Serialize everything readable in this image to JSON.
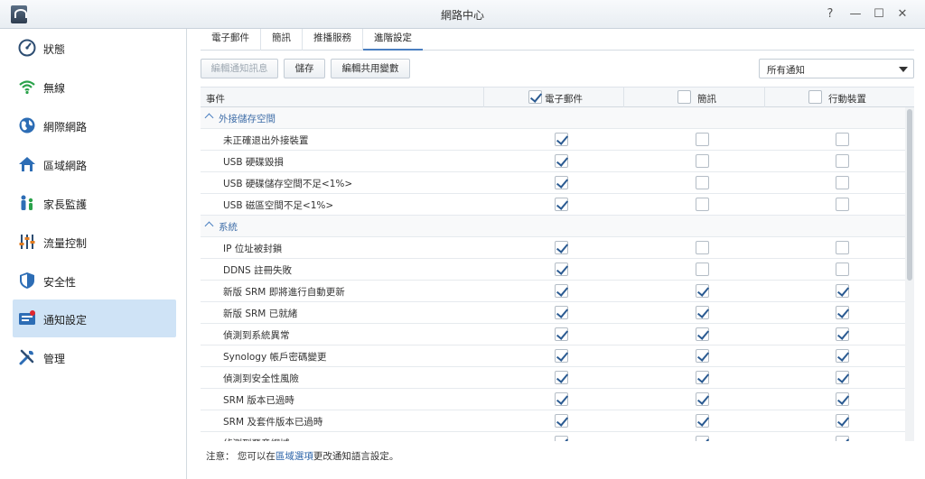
{
  "window": {
    "title": "網路中心",
    "help": "?",
    "minimize": "—",
    "maximize": "☐",
    "close": "✕"
  },
  "sidebar": {
    "items": [
      {
        "label": "狀態",
        "icon": "gauge-icon"
      },
      {
        "label": "無線",
        "icon": "wifi-icon"
      },
      {
        "label": "網際網路",
        "icon": "globe-icon"
      },
      {
        "label": "區域網路",
        "icon": "home-network-icon"
      },
      {
        "label": "家長監護",
        "icon": "family-icon"
      },
      {
        "label": "流量控制",
        "icon": "sliders-icon"
      },
      {
        "label": "安全性",
        "icon": "shield-icon"
      },
      {
        "label": "通知設定",
        "icon": "notification-icon"
      },
      {
        "label": "管理",
        "icon": "tools-icon"
      }
    ],
    "active_index": 7
  },
  "tabs": [
    "電子郵件",
    "簡訊",
    "推播服務",
    "進階設定"
  ],
  "active_tab": 3,
  "toolbar": {
    "edit_message": "編輯通知訊息",
    "save": "儲存",
    "edit_variables": "編輯共用變數",
    "filter_value": "所有通知"
  },
  "grid": {
    "columns": [
      "事件",
      "電子郵件",
      "簡訊",
      "行動裝置"
    ],
    "header_checked": [
      true,
      false,
      false
    ],
    "rows": [
      {
        "type": "group",
        "label": "外接儲存空間"
      },
      {
        "type": "item",
        "label": "未正確退出外接裝置",
        "checks": [
          true,
          false,
          false
        ]
      },
      {
        "type": "item",
        "label": "USB 硬碟毀損",
        "checks": [
          true,
          false,
          false
        ]
      },
      {
        "type": "item",
        "label": "USB 硬碟儲存空間不足<1%>",
        "checks": [
          true,
          false,
          false
        ]
      },
      {
        "type": "item",
        "label": "USB 磁區空間不足<1%>",
        "checks": [
          true,
          false,
          false
        ]
      },
      {
        "type": "group",
        "label": "系統"
      },
      {
        "type": "item",
        "label": "IP 位址被封鎖",
        "checks": [
          true,
          false,
          false
        ]
      },
      {
        "type": "item",
        "label": "DDNS 註冊失敗",
        "checks": [
          true,
          false,
          false
        ]
      },
      {
        "type": "item",
        "label": "新版 SRM 即將進行自動更新",
        "checks": [
          true,
          true,
          true
        ]
      },
      {
        "type": "item",
        "label": "新版 SRM 已就緒",
        "checks": [
          true,
          true,
          true
        ]
      },
      {
        "type": "item",
        "label": "偵測到系統異常",
        "checks": [
          true,
          true,
          true
        ]
      },
      {
        "type": "item",
        "label": "Synology 帳戶密碼變更",
        "checks": [
          true,
          true,
          true
        ]
      },
      {
        "type": "item",
        "label": "偵測到安全性風險",
        "checks": [
          true,
          true,
          true
        ]
      },
      {
        "type": "item",
        "label": "SRM 版本已過時",
        "checks": [
          true,
          true,
          true
        ]
      },
      {
        "type": "item",
        "label": "SRM 及套件版本已過時",
        "checks": [
          true,
          true,
          true
        ]
      },
      {
        "type": "item",
        "label": "偵測到惡意網域",
        "checks": [
          true,
          true,
          true
        ]
      }
    ]
  },
  "note": {
    "prefix": "注意： 您可以在",
    "link": "區域選項",
    "suffix": "更改通知語言設定。"
  }
}
